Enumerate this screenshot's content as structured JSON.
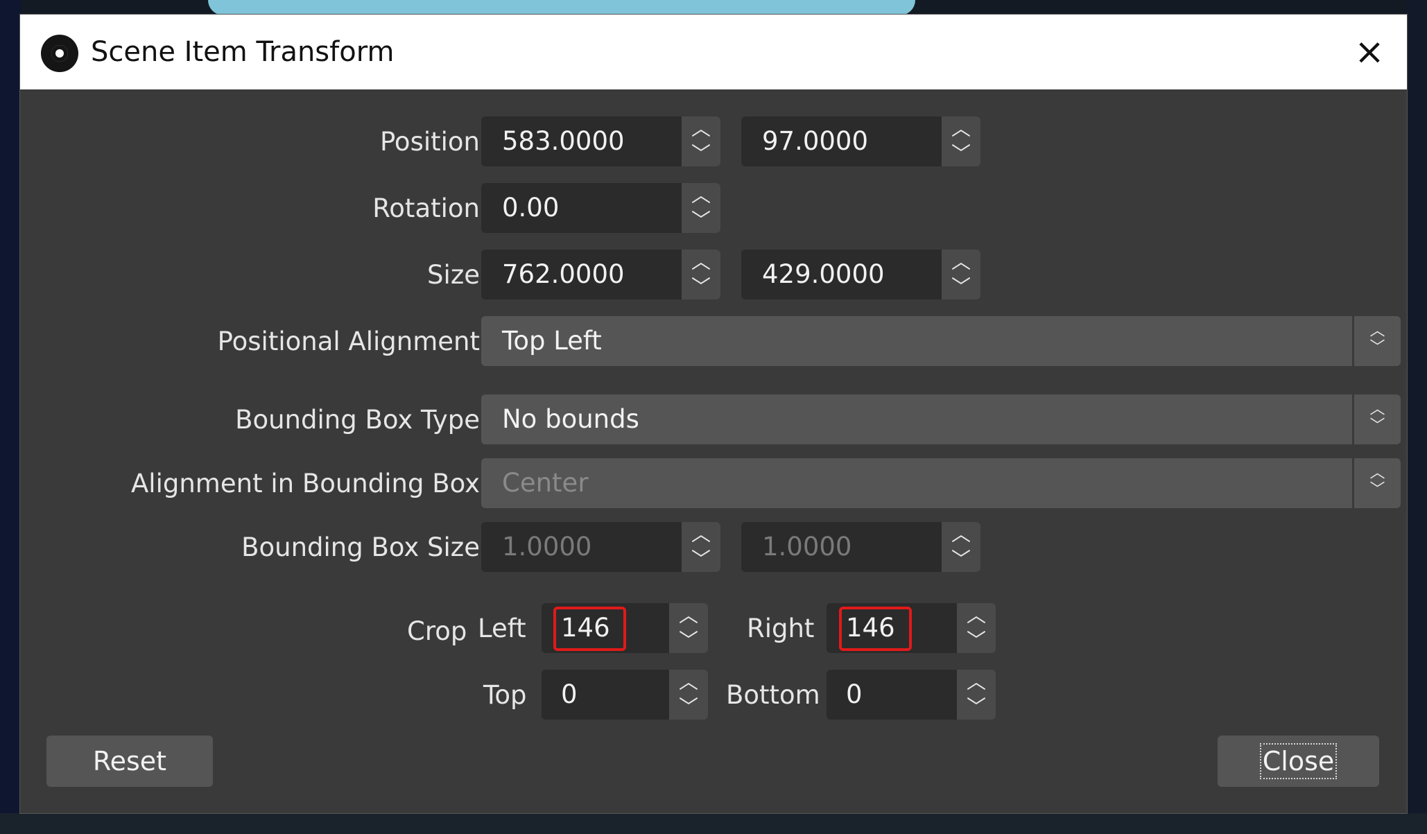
{
  "window": {
    "title": "Scene Item Transform",
    "close_glyph": "×",
    "icon": "obs-logo-icon"
  },
  "labels": {
    "position": "Position",
    "rotation": "Rotation",
    "size": "Size",
    "positional_alignment": "Positional Alignment",
    "bounding_box_type": "Bounding Box Type",
    "alignment_in_bounding_box": "Alignment in Bounding Box",
    "bounding_box_size": "Bounding Box Size",
    "crop": "Crop",
    "crop_left": "Left",
    "crop_right": "Right",
    "crop_top": "Top",
    "crop_bottom": "Bottom"
  },
  "values": {
    "position_x": "583.0000",
    "position_y": "97.0000",
    "rotation": "0.00",
    "size_w": "762.0000",
    "size_h": "429.0000",
    "positional_alignment": "Top Left",
    "bounding_box_type": "No bounds",
    "alignment_in_bounding_box": "Center",
    "bbox_w": "1.0000",
    "bbox_h": "1.0000",
    "crop_left": "146",
    "crop_right": "146",
    "crop_top": "0",
    "crop_bottom": "0"
  },
  "glyphs": {
    "up": "︿",
    "down": "﹀",
    "combo_up": "︿",
    "combo_down": "﹀"
  },
  "buttons": {
    "reset": "Reset",
    "close": "Close"
  },
  "colors": {
    "highlight": "#e01a1a",
    "dialog_bg": "#3a3a3a"
  }
}
